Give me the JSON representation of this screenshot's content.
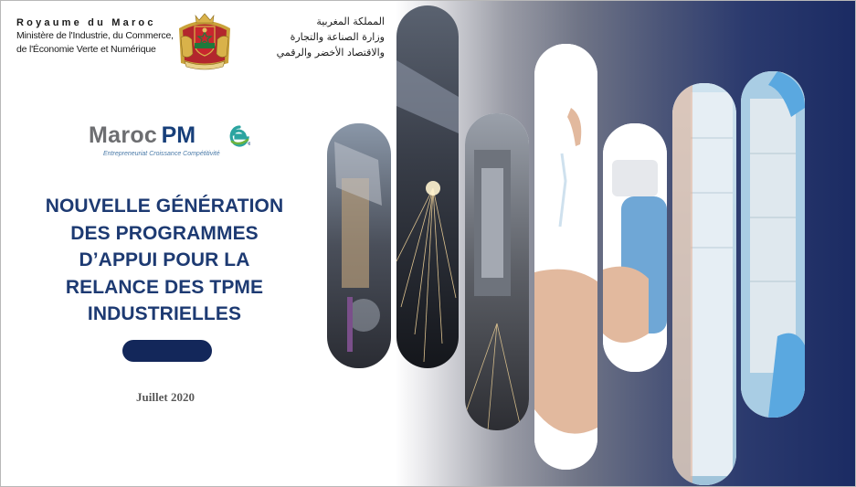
{
  "header": {
    "fr_line1": "Royaume du Maroc",
    "fr_line2": "Ministère de l'Industrie, du Commerce,",
    "fr_line3": "de l'Économie Verte et Numérique",
    "ar_line1": "المملكة المغربية",
    "ar_line2": "وزارة الصناعة والتجارة",
    "ar_line3": "والاقتصاد الأخضر والرقمي"
  },
  "logo": {
    "maroc": "Maroc",
    "pme": "PM",
    "tagline": "Entrepreneuriat  Croissance  Compétitivité",
    "accent_colors": [
      "#173f7a",
      "#6d6e71",
      "#2aa4a0",
      "#6cb33e"
    ]
  },
  "title": {
    "lines": [
      "NOUVELLE GÉNÉRATION",
      "DES PROGRAMMES",
      "D’APPUI POUR LA",
      "RELANCE DES TPME",
      "INDUSTRIELLES"
    ]
  },
  "date": "Juillet 2020",
  "colors": {
    "title": "#1d3a72",
    "pill": "#13275a",
    "panel_dark": "#1b2b63"
  }
}
